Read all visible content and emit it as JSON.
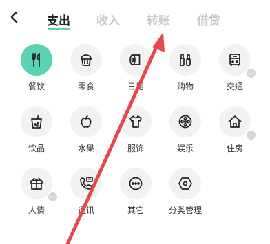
{
  "header": {
    "tabs": [
      {
        "label": "支出",
        "active": true
      },
      {
        "label": "收入",
        "active": false
      },
      {
        "label": "转账",
        "active": false
      },
      {
        "label": "借贷",
        "active": false
      }
    ]
  },
  "categories": [
    {
      "label": "餐饮",
      "icon": "utensils-icon",
      "selected": true
    },
    {
      "label": "零食",
      "icon": "cupcake-icon"
    },
    {
      "label": "日用",
      "icon": "tissue-roll-icon"
    },
    {
      "label": "购物",
      "icon": "cosmetics-icon"
    },
    {
      "label": "交通",
      "icon": "bus-icon",
      "more": true
    },
    {
      "label": "饮品",
      "icon": "bubble-tea-icon"
    },
    {
      "label": "水果",
      "icon": "apple-icon"
    },
    {
      "label": "服饰",
      "icon": "tshirt-icon"
    },
    {
      "label": "娱乐",
      "icon": "film-reel-icon"
    },
    {
      "label": "住房",
      "icon": "house-icon",
      "more": true
    },
    {
      "label": "人情",
      "icon": "gift-icon",
      "more": true
    },
    {
      "label": "通讯",
      "icon": "phone-message-icon"
    },
    {
      "label": "其它",
      "icon": "ellipsis-icon"
    },
    {
      "label": "分类管理",
      "icon": "settings-hexagon-icon"
    }
  ],
  "colors": {
    "accent": "#5ad3b4",
    "circle_bg": "#f2f2f2",
    "annotation_arrow": "#e8474c"
  }
}
